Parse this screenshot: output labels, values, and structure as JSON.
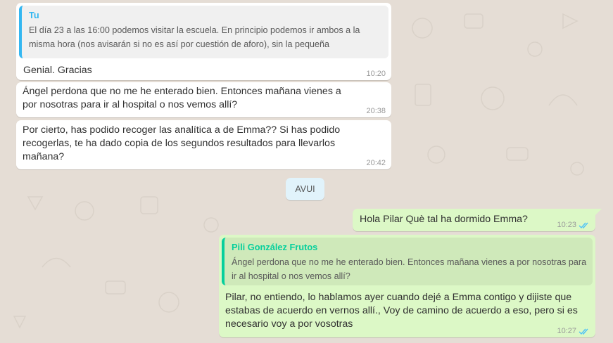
{
  "colors": {
    "background": "#e5ddd5",
    "incoming_bubble": "#ffffff",
    "outgoing_bubble": "#dcf8c6",
    "quote_accent_incoming": "#34b7f1",
    "quote_accent_outgoing": "#06cf9c",
    "read_ticks": "#4fc3f7"
  },
  "messages": [
    {
      "direction": "incoming",
      "quote": {
        "author": "Tu",
        "text": "El día 23 a las 16:00 podemos visitar la escuela. En principio podemos ir ambos a la misma hora (nos avisarán si no es así por cuestión de aforo), sin la pequeña"
      },
      "text": "Genial. Gracias",
      "time": "10:20"
    },
    {
      "direction": "incoming",
      "text": "Ángel perdona que no me he enterado bien. Entonces mañana vienes a por nosotras para ir al hospital o nos vemos allí?",
      "time": "20:38"
    },
    {
      "direction": "incoming",
      "text": "Por cierto, has podido recoger las analítica a de Emma?? Si has podido recogerlas, te ha dado copia de los segundos resultados para llevarlos mañana?",
      "time": "20:42"
    },
    {
      "direction": "outgoing",
      "text": "Hola Pilar Què tal ha dormido Emma?",
      "time": "10:23",
      "status": "read-double-tick-icon"
    },
    {
      "direction": "outgoing",
      "quote": {
        "author": "Pili González Frutos",
        "text": "Ángel perdona que no me he enterado bien. Entonces mañana vienes a por nosotras para ir al hospital o nos vemos allí?"
      },
      "text": "Pilar, no entiendo, lo hablamos ayer cuando dejé a Emma contigo y dijiste que estabas de acuerdo en vernos allí., Voy de camino de acuerdo a eso, pero si es necesario voy a por vosotras",
      "time": "10:27",
      "status": "read-double-tick-icon"
    }
  ],
  "date_divider": "AVUI"
}
